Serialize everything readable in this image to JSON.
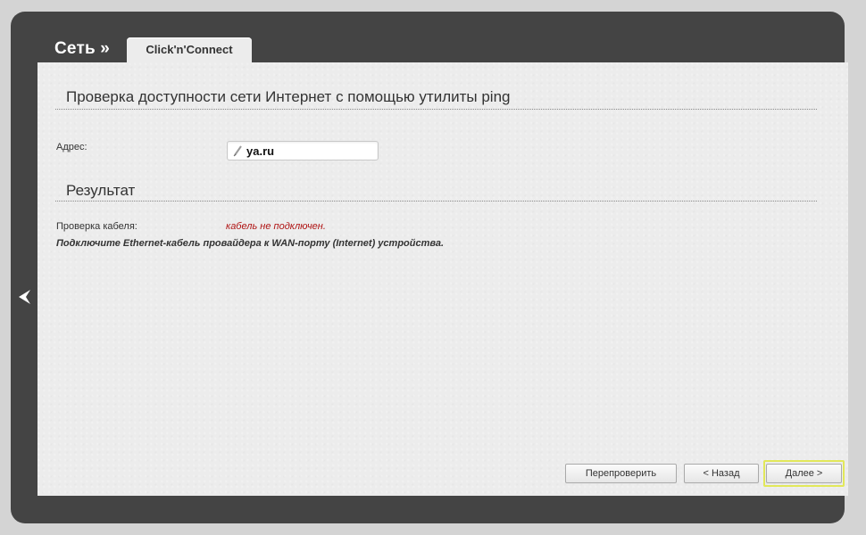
{
  "header": {
    "section_title": "Сеть »",
    "tab_label": "Click'n'Connect"
  },
  "ping": {
    "heading": "Проверка доступности сети Интернет с помощью утилиты ping",
    "address_label": "Адрес:",
    "address_value": "ya.ru"
  },
  "result": {
    "heading": "Результат",
    "cable_check_label": "Проверка кабеля:",
    "cable_check_status": "кабель не подключен.",
    "hint": "Подключите Ethernet-кабель провайдера к WAN-порту (Internet) устройства."
  },
  "buttons": {
    "recheck": "Перепроверить",
    "back": "< Назад",
    "next": "Далее >"
  },
  "colors": {
    "frame": "#444444",
    "panel": "#ececec",
    "error_text": "#b01515",
    "focus_ring": "#e2e85a"
  },
  "icons": {
    "address_icon": "pencil-icon",
    "side_nav": "chevron-left-icon"
  }
}
